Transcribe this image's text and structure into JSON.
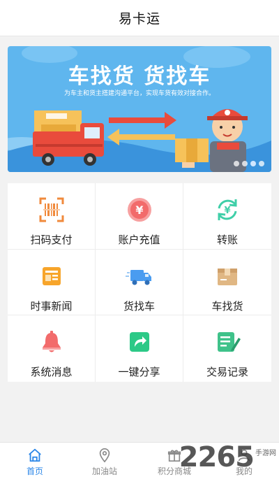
{
  "header": {
    "title": "易卡运"
  },
  "banner": {
    "headline": "车找货 货找车",
    "subtitle": "为车主和货主搭建沟通平台，实现车货有效对接合作。",
    "page_count": 4,
    "active_index": 2
  },
  "menu": {
    "items": [
      {
        "label": "扫码支付",
        "icon": "barcode-scan-icon",
        "color": "#f08a3c"
      },
      {
        "label": "账户充值",
        "icon": "yuan-coin-icon",
        "color": "#f26b6b"
      },
      {
        "label": "转账",
        "icon": "transfer-icon",
        "color": "#3fcfa8"
      },
      {
        "label": "时事新闻",
        "icon": "news-icon",
        "color": "#f7a52b"
      },
      {
        "label": "货找车",
        "icon": "truck-icon",
        "color": "#4a9cf0"
      },
      {
        "label": "车找货",
        "icon": "box-icon",
        "color": "#e0b784"
      },
      {
        "label": "系统消息",
        "icon": "bell-icon",
        "color": "#f26b6b"
      },
      {
        "label": "一键分享",
        "icon": "share-icon",
        "color": "#2cc987"
      },
      {
        "label": "交易记录",
        "icon": "record-icon",
        "color": "#3fc28a"
      }
    ]
  },
  "tabbar": {
    "items": [
      {
        "label": "首页",
        "icon": "home-icon",
        "active": true
      },
      {
        "label": "加油站",
        "icon": "location-pin-icon",
        "active": false
      },
      {
        "label": "积分商城",
        "icon": "gift-icon",
        "active": false
      },
      {
        "label": "我的",
        "icon": "user-icon",
        "active": false
      }
    ],
    "active_color": "#2a86e8"
  },
  "watermark": {
    "number": "2265",
    "sub": "手游网"
  }
}
